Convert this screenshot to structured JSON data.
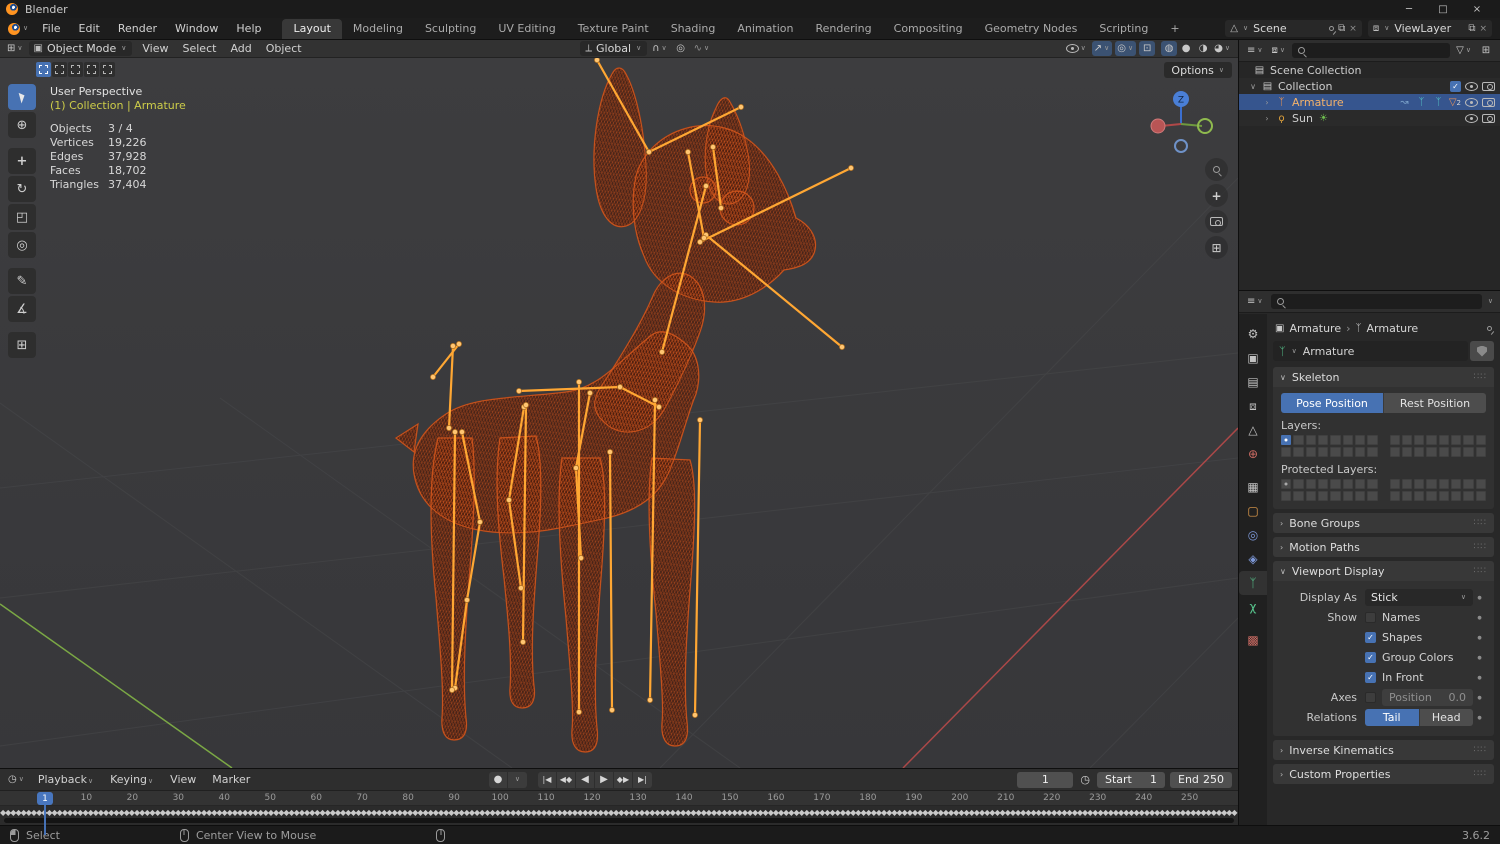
{
  "window": {
    "title": "Blender"
  },
  "topbar": {
    "menus": [
      "File",
      "Edit",
      "Render",
      "Window",
      "Help"
    ],
    "tabs": [
      "Layout",
      "Modeling",
      "Sculpting",
      "UV Editing",
      "Texture Paint",
      "Shading",
      "Animation",
      "Rendering",
      "Compositing",
      "Geometry Nodes",
      "Scripting",
      "+"
    ],
    "active_tab": "Layout",
    "scene_name": "Scene",
    "view_layer_name": "ViewLayer"
  },
  "viewport_header": {
    "mode": "Object Mode",
    "menus": [
      "View",
      "Select",
      "Add",
      "Object"
    ],
    "orientation": "Global",
    "options": "Options"
  },
  "viewport": {
    "view_label": "User Perspective",
    "context_label": "(1) Collection | Armature",
    "stats": [
      {
        "label": "Objects",
        "value": "3 / 4"
      },
      {
        "label": "Vertices",
        "value": "19,226"
      },
      {
        "label": "Edges",
        "value": "37,928"
      },
      {
        "label": "Faces",
        "value": "18,702"
      },
      {
        "label": "Triangles",
        "value": "37,404"
      }
    ],
    "gizmo_z": "Z"
  },
  "outliner": {
    "rows": [
      {
        "label": "Scene Collection"
      },
      {
        "label": "Collection",
        "checked": true
      },
      {
        "label": "Armature",
        "selected": true,
        "badge": "2"
      },
      {
        "label": "Sun"
      }
    ]
  },
  "properties": {
    "breadcrumb": {
      "object": "Armature",
      "data": "Armature"
    },
    "name_value": "Armature",
    "skeleton": {
      "title": "Skeleton",
      "pose": "Pose Position",
      "rest": "Rest Position",
      "layers": "Layers:",
      "protected_layers": "Protected Layers:"
    },
    "sections": {
      "bone_groups": "Bone Groups",
      "motion_paths": "Motion Paths",
      "viewport_display": "Viewport Display",
      "inverse_kinematics": "Inverse Kinematics",
      "custom_properties": "Custom Properties"
    },
    "viewport_display": {
      "display_as_label": "Display As",
      "display_as": "Stick",
      "show_label": "Show",
      "toggles": [
        {
          "label": "Names",
          "checked": false
        },
        {
          "label": "Shapes",
          "checked": true
        },
        {
          "label": "Group Colors",
          "checked": true
        },
        {
          "label": "In Front",
          "checked": true
        }
      ],
      "axes_label": "Axes",
      "axes_checked": false,
      "position_placeholder": "Position",
      "position_value": "0.0",
      "relations_label": "Relations",
      "tail": "Tail",
      "head": "Head"
    },
    "tabs": [
      {
        "name": "tool",
        "glyph": "⚙",
        "color": "#c2c2c2"
      },
      {
        "name": "render",
        "glyph": "▣",
        "color": "#c2c2c2"
      },
      {
        "name": "output",
        "glyph": "▤",
        "color": "#c2c2c2"
      },
      {
        "name": "view-layer",
        "glyph": "⧈",
        "color": "#c2c2c2"
      },
      {
        "name": "scene",
        "glyph": "△",
        "color": "#c2c2c2"
      },
      {
        "name": "world",
        "glyph": "⊕",
        "color": "#cc6b63"
      },
      {
        "name": "collection",
        "glyph": "▦",
        "color": "#c2c2c2",
        "gap": true
      },
      {
        "name": "object",
        "glyph": "▢",
        "color": "#e8a04c"
      },
      {
        "name": "physics",
        "glyph": "◎",
        "color": "#7d98d8"
      },
      {
        "name": "constraints",
        "glyph": "◈",
        "color": "#7d98d8"
      },
      {
        "name": "object-data",
        "glyph": "ᛉ",
        "color": "#58c58d",
        "active": true
      },
      {
        "name": "bone",
        "glyph": "χ",
        "color": "#58c58d"
      },
      {
        "name": "texture",
        "glyph": "▩",
        "color": "#cc6b63",
        "gap": true
      }
    ]
  },
  "timeline": {
    "menus": [
      "Playback",
      "Keying",
      "View",
      "Marker"
    ],
    "current_frame": "1",
    "start_label": "Start",
    "start_value": "1",
    "end_label": "End",
    "end_value": "250",
    "tick_start": 10,
    "tick_end": 250,
    "tick_step": 10
  },
  "status": {
    "hint_select": "Select",
    "hint_center": "Center View to Mouse",
    "version": "3.6.2"
  },
  "colors": {
    "accent": "#4772b3",
    "blender_orange": "#e87d0d",
    "selection_blue": "#36558e",
    "bone_orange": "#ffa733",
    "wire_orange": "#cf4a1d",
    "context_yellow": "#cdcd49"
  },
  "icons": {
    "chevron_down": "∨",
    "expander_closed": "›",
    "expander_open": "∨",
    "minimize": "─",
    "maximize": "□",
    "close": "×",
    "copy": "⧉",
    "unlink": "×",
    "scene": "△",
    "view_layer": "⧈",
    "editor_generic": "⊞",
    "mode_object": "▣",
    "orientation": "⟂",
    "snap_magnet": "∩",
    "proportional": "◎",
    "falloff": "∿",
    "gizmo_toggle": "↗",
    "overlays_toggle": "◎",
    "xray_toggle": "⊡",
    "shading_wire": "◍",
    "shading_solid": "●",
    "shading_material": "◑",
    "shading_render": "◕",
    "tool_cursor": "⊕",
    "tool_move": "+",
    "tool_rotate": "↻",
    "tool_scale": "◰",
    "tool_transform": "◎",
    "tool_annotate": "✎",
    "tool_measure": "∡",
    "tool_addcube": "⊞",
    "pan_hand": "+",
    "ortho_grid": "⊞",
    "filter_tree": "≡",
    "display_mode": "⧈",
    "funnel": "▽",
    "new_collection": "⊞",
    "collection": "▤",
    "armature": "ᛉ",
    "sun_bulb": "ϙ",
    "sun_rays": "☀",
    "anim_decorator": "↝",
    "pose_decorator": "ᛉ",
    "badge_triangle": "▽",
    "check": "✓",
    "properties_editor": "≡",
    "clock": "◷",
    "record": "●",
    "play_first": "|◀",
    "play_prev_key": "◀◆",
    "play_rev": "◀",
    "play_fwd": "▶",
    "play_next_key": "◆▶",
    "play_last": "▶|",
    "grip": "∷∷",
    "anim_dot": "●"
  }
}
